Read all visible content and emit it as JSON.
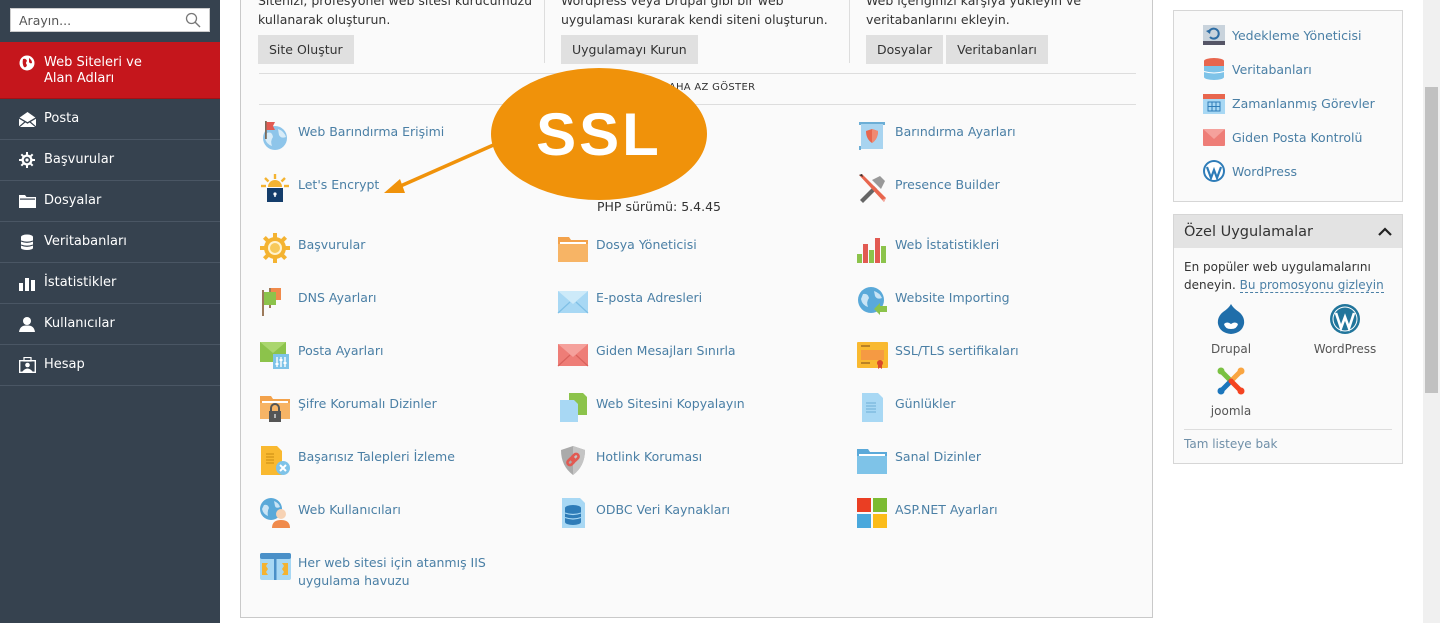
{
  "sidebar": {
    "search_placeholder": "Arayın...",
    "items": [
      {
        "label": "Web Siteleri ve Alan Adları",
        "icon": "globe-icon",
        "active": true
      },
      {
        "label": "Posta",
        "icon": "mail-icon"
      },
      {
        "label": "Başvurular",
        "icon": "gear-icon"
      },
      {
        "label": "Dosyalar",
        "icon": "folder-icon"
      },
      {
        "label": "Veritabanları",
        "icon": "database-icon"
      },
      {
        "label": "İstatistikler",
        "icon": "bar-chart-icon"
      },
      {
        "label": "Kullanıcılar",
        "icon": "user-icon"
      },
      {
        "label": "Hesap",
        "icon": "account-icon"
      }
    ]
  },
  "promo": {
    "col1": {
      "line1": "Sitenizi, profesyonel web sitesi kurucumuzu",
      "line2": "kullanarak oluşturun.",
      "button": "Site Oluştur"
    },
    "col2": {
      "line1": "Wordpress veya Drupal gibi bir web",
      "line2": "uygulaması kurarak kendi siteni oluşturun.",
      "button": "Uygulamayı Kurun"
    },
    "col3": {
      "line1": "Web içeriğinizi karşıya yükleyin ve",
      "line2": "veritabanlarını ekleyin.",
      "buttons": [
        "Dosyalar",
        "Veritabanları"
      ]
    }
  },
  "toggle_label": "DAHA AZ GÖSTER",
  "php_version": "PHP sürümü: 5.4.45",
  "callout_label": "SSL",
  "tools": [
    {
      "label": "Web Barındırma Erişimi",
      "icon": "hosting-access-icon"
    },
    {
      "label": "Barındırma Ayarları",
      "icon": "hosting-settings-icon"
    },
    {
      "label": "Let's Encrypt",
      "icon": "lets-encrypt-icon"
    },
    {
      "label": "Presence Builder",
      "icon": "presence-builder-icon"
    },
    {
      "label": "Başvurular",
      "icon": "applications-gear-icon"
    },
    {
      "label": "Dosya Yöneticisi",
      "icon": "file-manager-icon"
    },
    {
      "label": "Web İstatistikleri",
      "icon": "web-stats-icon"
    },
    {
      "label": "DNS Ayarları",
      "icon": "dns-flags-icon"
    },
    {
      "label": "E-posta Adresleri",
      "icon": "email-envelope-icon"
    },
    {
      "label": "Website Importing",
      "icon": "website-import-icon"
    },
    {
      "label": "Posta Ayarları",
      "icon": "mail-settings-icon"
    },
    {
      "label": "Giden Mesajları Sınırla",
      "icon": "outgoing-mail-limit-icon"
    },
    {
      "label": "SSL/TLS sertifikaları",
      "icon": "certificate-icon"
    },
    {
      "label": "Şifre Korumalı Dizinler",
      "icon": "protected-folder-icon"
    },
    {
      "label": "Web Sitesini Kopyalayın",
      "icon": "copy-site-icon"
    },
    {
      "label": "Günlükler",
      "icon": "logs-icon"
    },
    {
      "label": "Başarısız Talepleri İzleme",
      "icon": "failed-requests-icon"
    },
    {
      "label": "Hotlink Koruması",
      "icon": "hotlink-shield-icon"
    },
    {
      "label": "Sanal Dizinler",
      "icon": "virtual-folder-icon"
    },
    {
      "label": "Web Kullanıcıları",
      "icon": "web-users-icon"
    },
    {
      "label": "ODBC Veri Kaynakları",
      "icon": "odbc-database-icon"
    },
    {
      "label": "ASP.NET Ayarları",
      "icon": "aspnet-windows-icon"
    },
    {
      "label": "Her web sitesi için atanmış IIS uygulama havuzu",
      "icon": "iis-pool-icon"
    }
  ],
  "right_links": [
    {
      "label": "Yedekleme Yöneticisi",
      "icon": "backup-icon"
    },
    {
      "label": "Veritabanları",
      "icon": "database-stack-icon"
    },
    {
      "label": "Zamanlanmış Görevler",
      "icon": "calendar-icon"
    },
    {
      "label": "Giden Posta Kontrolü",
      "icon": "outgoing-mail-icon"
    },
    {
      "label": "WordPress",
      "icon": "wordpress-icon"
    }
  ],
  "apps_panel": {
    "title": "Özel Uygulamalar",
    "desc": "En popüler web uygulamalarını deneyin.",
    "hide_link": "Bu promosyonu gizleyin",
    "apps": [
      {
        "label": "Drupal",
        "icon": "drupal-icon"
      },
      {
        "label": "WordPress",
        "icon": "wordpress-logo-icon"
      },
      {
        "label": "joomla",
        "icon": "joomla-icon"
      }
    ],
    "full_list": "Tam listeye bak"
  }
}
